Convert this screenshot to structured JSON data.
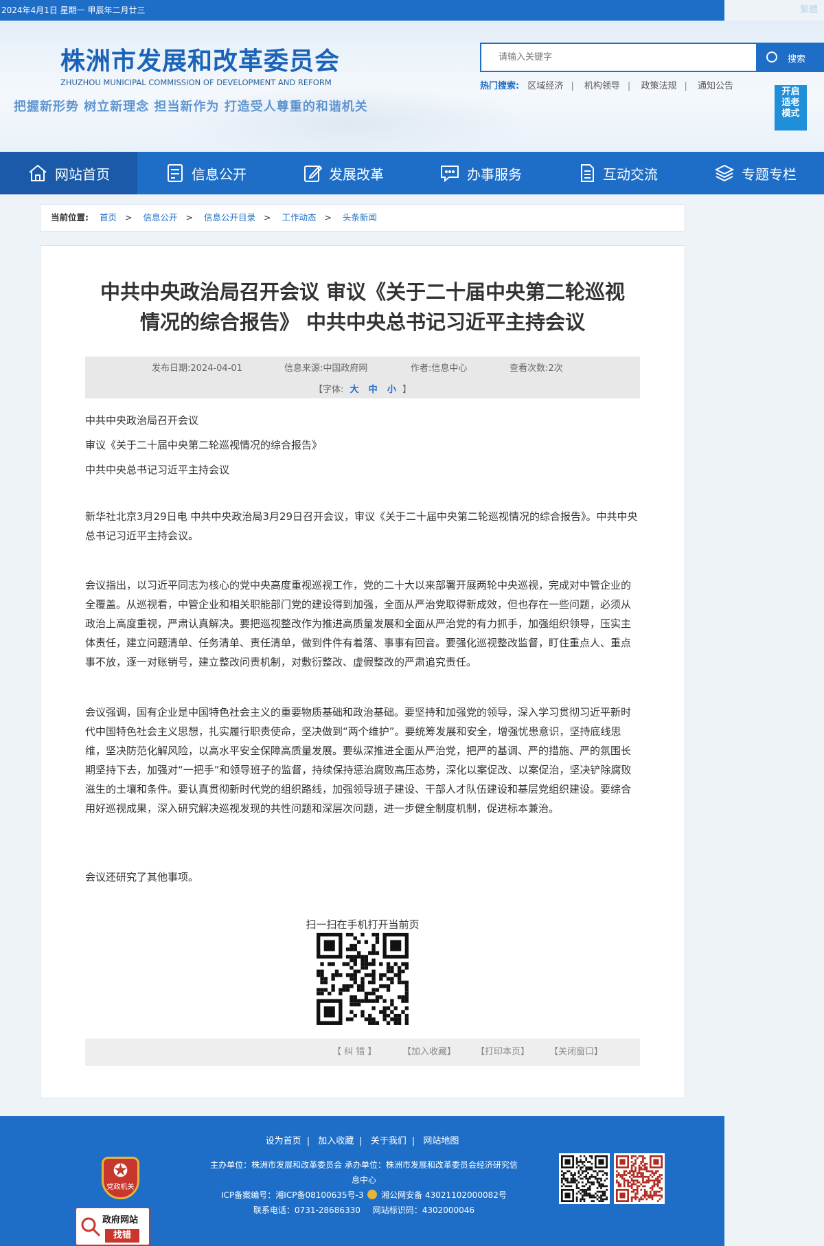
{
  "topbar": {
    "date_text": "2024年4月1日  星期一   甲辰年二月廿三",
    "right_text": "繁體"
  },
  "header": {
    "site_name": "株洲市发展和改革委员会",
    "site_name_en": "ZHUZHOU MUNICIPAL COMMISSION OF DEVELOPMENT AND REFORM",
    "slogan": "把握新形势 树立新理念 担当新作为 打造受人尊重的和谐机关",
    "search_placeholder": "请输入关键字",
    "search_button": "搜索",
    "hot_label": "热门搜索:",
    "hot_items": [
      "区域经济",
      "机构领导",
      "政策法规",
      "通知公告"
    ],
    "accessibility_lines": [
      "开启",
      "适老",
      "模式"
    ]
  },
  "nav": [
    {
      "label": "网站首页",
      "icon": "home-icon"
    },
    {
      "label": "信息公开",
      "icon": "document-list-icon"
    },
    {
      "label": "发展改革",
      "icon": "edit-icon"
    },
    {
      "label": "办事服务",
      "icon": "chat-icon"
    },
    {
      "label": "互动交流",
      "icon": "file-text-icon"
    },
    {
      "label": "专题专栏",
      "icon": "layers-icon"
    }
  ],
  "breadcrumb": {
    "label": "当前位置:",
    "items": [
      "首页",
      "信息公开",
      "信息公开目录",
      "工作动态",
      "头条新闻"
    ]
  },
  "article": {
    "title_line1": "中共中央政治局召开会议 审议《关于二十届中央第二轮巡视",
    "title_line2": "情况的综合报告》 中共中央总书记习近平主持会议",
    "meta": {
      "date": "发布日期:2024-04-01",
      "source": "信息来源:中国政府网",
      "author": "作者:信息中心",
      "views": "查看次数:2次",
      "font_prefix": "【字体:",
      "font_sizes": [
        "大",
        "中",
        "小"
      ],
      "font_suffix": "】"
    },
    "subheads": [
      "中共中央政治局召开会议",
      "审议《关于二十届中央第二轮巡视情况的综合报告》",
      "中共中央总书记习近平主持会议"
    ],
    "paragraphs": [
      "新华社北京3月29日电  中共中央政治局3月29日召开会议，审议《关于二十届中央第二轮巡视情况的综合报告》。中共中央总书记习近平主持会议。",
      "会议指出，以习近平同志为核心的党中央高度重视巡视工作，党的二十大以来部署开展两轮中央巡视，完成对中管企业的全覆盖。从巡视看，中管企业和相关职能部门党的建设得到加强，全面从严治党取得新成效，但也存在一些问题，必须从政治上高度重视，严肃认真解决。要把巡视整改作为推进高质量发展和全面从严治党的有力抓手，加强组织领导，压实主体责任，建立问题清单、任务清单、责任清单，做到件件有着落、事事有回音。要强化巡视整改监督，盯住重点人、重点事不放，逐一对账销号，建立整改问责机制，对敷衍整改、虚假整改的严肃追究责任。",
      "会议强调，国有企业是中国特色社会主义的重要物质基础和政治基础。要坚持和加强党的领导，深入学习贯彻习近平新时代中国特色社会主义思想，扎实履行职责使命，坚决做到“两个维护”。要统筹发展和安全，增强忧患意识，坚持底线思维，坚决防范化解风险，以高水平安全保障高质量发展。要纵深推进全面从严治党，把严的基调、严的措施、严的氛围长期坚持下去，加强对“一把手”和领导班子的监督，持续保持惩治腐败高压态势，深化以案促改、以案促治，坚决铲除腐败滋生的土壤和条件。要认真贯彻新时代党的组织路线，加强领导班子建设、干部人才队伍建设和基层党组织建设。要综合用好巡视成果，深入研究解决巡视发现的共性问题和深层次问题，进一步健全制度机制，促进标本兼治。",
      "会议还研究了其他事项。"
    ],
    "qr_caption": "扫一扫在手机打开当前页",
    "actions": [
      "【 纠 错 】",
      "【加入收藏】",
      "【打印本页】",
      "【关闭窗口】"
    ]
  },
  "footer": {
    "links": [
      "设为首页",
      "加入收藏",
      "关于我们",
      "网站地图"
    ],
    "sponsor_line1": "主办单位：株洲市发展和改革委员会 承办单位：株洲市发展和改革委员会经济研究信",
    "sponsor_line2": "息中心",
    "icp": "ICP备案编号：湘ICP备08100635号-3",
    "police": "湘公网安备 43021102000082号",
    "phone": "联系电话：0731-28686330",
    "site_code": "网站标识码：4302000046",
    "badge_text": "党政机关",
    "find_error_line1": "政府网站",
    "find_error_line2": "找错"
  },
  "colors": {
    "brand_blue": "#1e6ec8",
    "nav_active": "#1a5aa8",
    "badge_red": "#c8372d"
  }
}
